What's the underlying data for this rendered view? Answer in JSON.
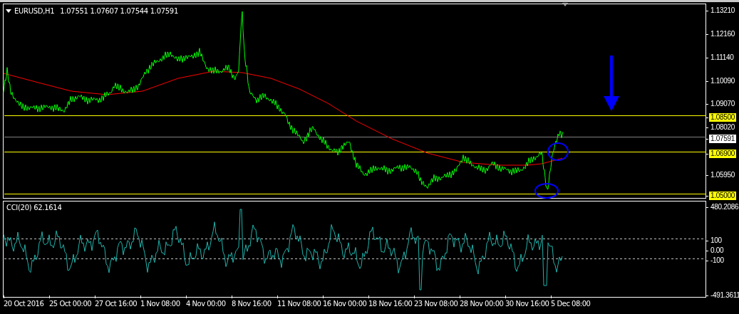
{
  "header": {
    "symbol": "EURUSD,H1",
    "ohlc": "1.07551 1.07607 1.07544 1.07591"
  },
  "price_axis": [
    {
      "label": "1.13210",
      "kind": "tick"
    },
    {
      "label": "1.12160",
      "kind": "tick"
    },
    {
      "label": "1.11140",
      "kind": "tick"
    },
    {
      "label": "1.10090",
      "kind": "tick"
    },
    {
      "label": "1.09070",
      "kind": "tick"
    },
    {
      "label": "1.08500",
      "kind": "level"
    },
    {
      "label": "1.08020",
      "kind": "tick"
    },
    {
      "label": "1.07591",
      "kind": "price"
    },
    {
      "label": "1.06900",
      "kind": "level"
    },
    {
      "label": "1.05950",
      "kind": "tick"
    },
    {
      "label": "1.05000",
      "kind": "level"
    }
  ],
  "indicator": {
    "title": "CCI(20) 62.1614",
    "axis": [
      {
        "label": "480.2086",
        "kind": "tick"
      },
      {
        "label": "100",
        "kind": "level"
      },
      {
        "label": "0.00",
        "kind": "tick"
      },
      {
        "label": "-100",
        "kind": "level"
      },
      {
        "label": "-491.3611",
        "kind": "tick"
      }
    ]
  },
  "time_axis": [
    "20 Oct 2016",
    "25 Oct 00:00",
    "27 Oct 16:00",
    "1 Nov 08:00",
    "4 Nov 00:00",
    "8 Nov 16:00",
    "11 Nov 08:00",
    "16 Nov 00:00",
    "18 Nov 16:00",
    "23 Nov 08:00",
    "28 Nov 00:00",
    "30 Nov 16:00",
    "5 Dec 08:00"
  ]
}
